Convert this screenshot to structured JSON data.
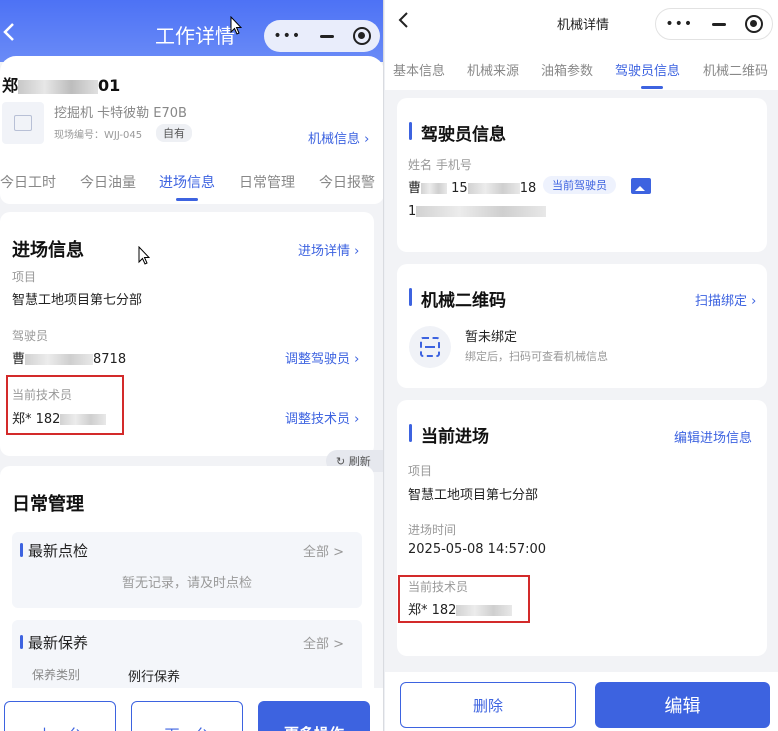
{
  "left": {
    "header": {
      "back_icon": "chevron-left-icon",
      "title": "工作详情"
    },
    "machine": {
      "name_prefix": "郑",
      "name_suffix": "01",
      "model": "挖掘机 卡特彼勒 E70B",
      "site_no": "现场编号：WJJ-045",
      "ownership": "自有",
      "info_link": "机械信息"
    },
    "tabs": [
      {
        "label": "今日工时"
      },
      {
        "label": "今日油量"
      },
      {
        "label": "进场信息"
      },
      {
        "label": "日常管理"
      },
      {
        "label": "今日报警"
      }
    ],
    "entry": {
      "title": "进场信息",
      "detail_link": "进场详情",
      "project_label": "项目",
      "project_value": "智慧工地项目第七分部",
      "driver_label": "驾驶员",
      "driver_value_prefix": "曹",
      "driver_value_suffix": "8718",
      "adjust_driver": "调整驾驶员",
      "tech_label": "当前技术员",
      "tech_value_prefix": "郑* 182",
      "adjust_tech": "调整技术员"
    },
    "refresh_label": "刷新",
    "daily": {
      "title": "日常管理",
      "inspection_title": "最新点检",
      "inspection_all": "全部",
      "inspection_empty": "暂无记录，请及时点检",
      "maintenance_title": "最新保养",
      "maintenance_all": "全部",
      "maintenance_type_label": "保养类别",
      "maintenance_type_value": "例行保养"
    },
    "footer": {
      "prev": "上一台",
      "next": "下一台",
      "more": "更多操作"
    }
  },
  "right": {
    "header": {
      "back_icon": "chevron-left-icon",
      "title": "机械详情"
    },
    "tabs": [
      {
        "label": "基本信息"
      },
      {
        "label": "机械来源"
      },
      {
        "label": "油箱参数"
      },
      {
        "label": "驾驶员信息"
      },
      {
        "label": "机械二维码"
      }
    ],
    "driver": {
      "title": "驾驶员信息",
      "col_label": "姓名 手机号",
      "name_prefix": "曹",
      "phone_prefix": "15",
      "phone_suffix": "18",
      "badge": "当前驾驶员",
      "id_prefix": "1"
    },
    "qr": {
      "title": "机械二维码",
      "scan_link": "扫描绑定",
      "status": "暂未绑定",
      "hint": "绑定后，扫码可查看机械信息"
    },
    "current": {
      "title": "当前进场",
      "edit_link": "编辑进场信息",
      "project_label": "项目",
      "project_value": "智慧工地项目第七分部",
      "time_label": "进场时间",
      "time_value": "2025-05-08 14:57:00",
      "tech_label": "当前技术员",
      "tech_value_prefix": "郑* 182"
    },
    "footer": {
      "delete": "删除",
      "edit": "编辑"
    }
  },
  "colors": {
    "accent": "#3d63e0",
    "header_gradient_start": "#4d72f5",
    "highlight_box": "#d32a2a"
  }
}
